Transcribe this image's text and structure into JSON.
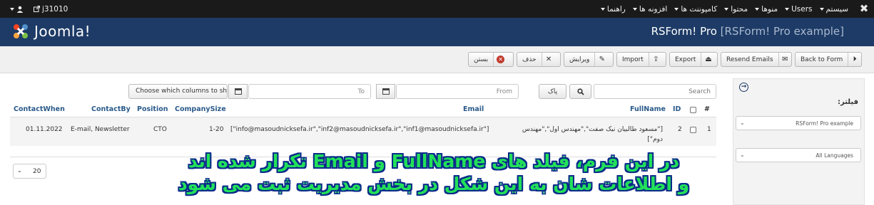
{
  "navbar": {
    "menu": [
      {
        "label": "سیستم"
      },
      {
        "label": "Users"
      },
      {
        "label": "منوها"
      },
      {
        "label": "محتوا"
      },
      {
        "label": "کامپوننت ها"
      },
      {
        "label": "افزونه ها"
      },
      {
        "label": "راهنما"
      }
    ],
    "site_name": "j31010",
    "user_icon": "user-icon",
    "brand_icon": "joomla-icon"
  },
  "header": {
    "logo_text": "Joomla!",
    "title": "RSForm! Pro",
    "title_sub": "[RSForm! Pro example]"
  },
  "toolbar": {
    "back_to_form": "Back to Form",
    "resend_emails": "Resend Emails",
    "export": "Export",
    "import": "Import",
    "edit": "ویرایش",
    "delete": "حذف",
    "close": "بستن"
  },
  "sidebar": {
    "filter_label": "فیلتر:",
    "form_select": "RSForm! Pro example",
    "language_select": "All Languages"
  },
  "search": {
    "placeholder": "Search",
    "clear_label": "پاک",
    "from_placeholder": "From",
    "to_placeholder": "To",
    "columns_select": "Choose which columns to show"
  },
  "table": {
    "headers": {
      "num": "#",
      "id": "ID",
      "fullname": "FullName",
      "email": "Email",
      "company_size": "CompanySize",
      "position": "Position",
      "contact_by": "ContactBy",
      "contact_when": "ContactWhen"
    },
    "rows": [
      {
        "num": "1",
        "id": "2",
        "fullname_line1": "[\"مسعود طالبیان نیک صفت\",\"مهندس اول\",\"مهندس",
        "fullname_line2": "دوم\"]",
        "email": "[\"info@masoudnicksefa.ir\",\"inf2@masoudnicksefa.ir\",\"inf1@masoudnicksefa.ir\"]",
        "company_size": "1-20",
        "position": "CTO",
        "contact_by": "E-mail, Newsletter",
        "contact_when": "01.11.2022"
      }
    ]
  },
  "pagination": {
    "limit": "20"
  },
  "caption": {
    "line1": "در این فرم، فیلد های FullName و Email تکرار شده اند",
    "line2": "و اطلاعات شان به این شکل در بخش مدیریت ثبت می شود"
  }
}
